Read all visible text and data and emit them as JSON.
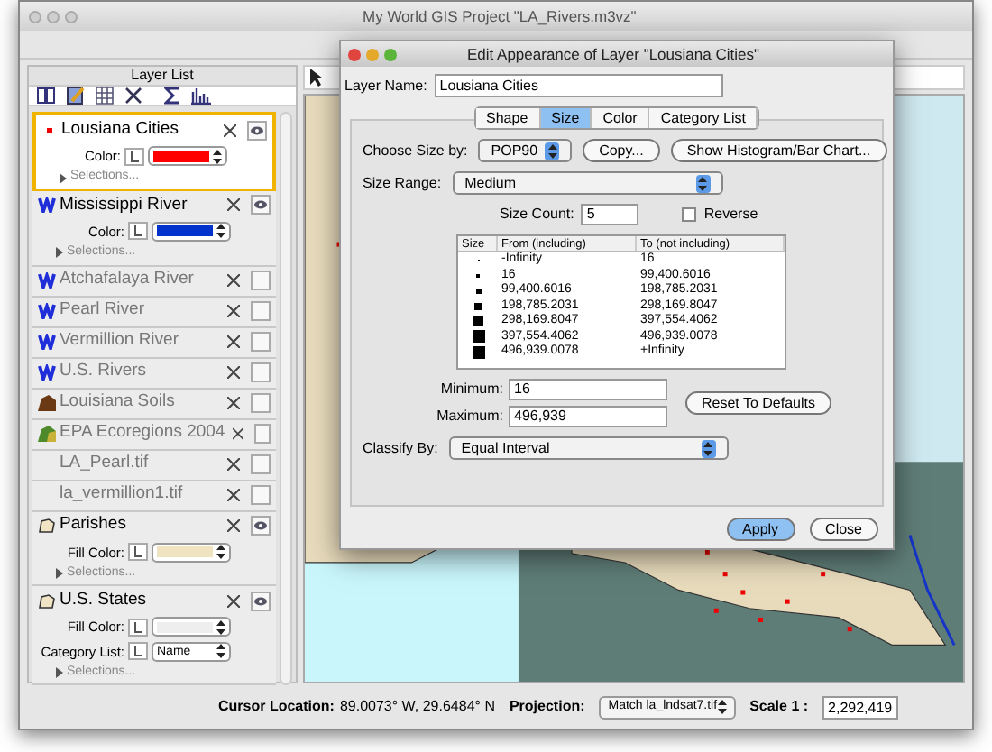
{
  "window": {
    "title": "My World GIS Project \"LA_Rivers.m3vz\""
  },
  "layer_panel": {
    "title": "Layer List",
    "layers": [
      {
        "name": "Lousiana Cities",
        "kind": "point",
        "selected": true,
        "visible": true,
        "controls": [
          {
            "label": "Color:",
            "kind": "color",
            "color": "#ff0000"
          }
        ],
        "selections": "Selections..."
      },
      {
        "name": "Mississippi  River",
        "kind": "line",
        "selected": false,
        "visible": true,
        "controls": [
          {
            "label": "Color:",
            "kind": "color",
            "color": "#0033cc"
          }
        ],
        "selections": "Selections..."
      },
      {
        "name": "Atchafalaya River",
        "kind": "line",
        "selected": false,
        "visible": false
      },
      {
        "name": "Pearl River",
        "kind": "line",
        "selected": false,
        "visible": false
      },
      {
        "name": "Vermillion River",
        "kind": "line",
        "selected": false,
        "visible": false
      },
      {
        "name": "U.S. Rivers",
        "kind": "line",
        "selected": false,
        "visible": false
      },
      {
        "name": "Louisiana Soils",
        "kind": "soil",
        "selected": false,
        "visible": false
      },
      {
        "name": "EPA Ecoregions 2004",
        "kind": "region",
        "selected": false,
        "visible": false
      },
      {
        "name": "LA_Pearl.tif",
        "kind": "image",
        "selected": false,
        "visible": false
      },
      {
        "name": "la_vermillion1.tif",
        "kind": "image",
        "selected": false,
        "visible": false
      },
      {
        "name": "Parishes",
        "kind": "polygon",
        "selected": false,
        "visible": true,
        "controls": [
          {
            "label": "Fill Color:",
            "kind": "color",
            "color": "#efe3c0"
          }
        ],
        "selections": "Selections..."
      },
      {
        "name": "U.S. States",
        "kind": "polygon",
        "selected": false,
        "visible": true,
        "controls": [
          {
            "label": "Fill Color:",
            "kind": "color",
            "color": "#eeeeee"
          },
          {
            "label": "Category List:",
            "kind": "select",
            "value": "Name"
          }
        ],
        "selections": "Selections..."
      }
    ]
  },
  "dialog": {
    "title": "Edit Appearance of Layer \"Lousiana Cities\"",
    "layer_name_label": "Layer Name:",
    "layer_name": "Lousiana Cities",
    "tabs": [
      {
        "label": "Shape",
        "selected": false
      },
      {
        "label": "Size",
        "selected": true
      },
      {
        "label": "Color",
        "selected": false
      },
      {
        "label": "Category List",
        "selected": false
      }
    ],
    "choose_size_label": "Choose Size by:",
    "choose_size_value": "POP90",
    "copy_button": "Copy...",
    "histogram_button": "Show Histogram/Bar Chart...",
    "size_range_label": "Size Range:",
    "size_range_value": "Medium",
    "size_count_label": "Size Count:",
    "size_count": "5",
    "reverse": {
      "label": "Reverse",
      "checked": false
    },
    "table": {
      "columns": [
        "Size",
        "From (including)",
        "To (not including)"
      ],
      "rows": [
        {
          "from": "-Infinity",
          "to": "16"
        },
        {
          "from": "16",
          "to": "99,400.6016"
        },
        {
          "from": "99,400.6016",
          "to": "198,785.2031"
        },
        {
          "from": "198,785.2031",
          "to": "298,169.8047"
        },
        {
          "from": "298,169.8047",
          "to": "397,554.4062"
        },
        {
          "from": "397,554.4062",
          "to": "496,939.0078"
        },
        {
          "from": "496,939.0078",
          "to": "+Infinity"
        }
      ]
    },
    "minimum_label": "Minimum:",
    "minimum": "16",
    "maximum_label": "Maximum:",
    "maximum": "496,939",
    "reset_button": "Reset To Defaults",
    "classify_label": "Classify By:",
    "classify_value": "Equal Interval",
    "apply_button": "Apply",
    "close_button": "Close"
  },
  "status_bar": {
    "cursor_label": "Cursor Location:",
    "cursor_value": "89.0073° W, 29.6484° N",
    "projection_label": "Projection:",
    "projection_value": "Match la_lndsat7.tif",
    "scale_label": "Scale 1 :",
    "scale_value": "2,292,419"
  }
}
